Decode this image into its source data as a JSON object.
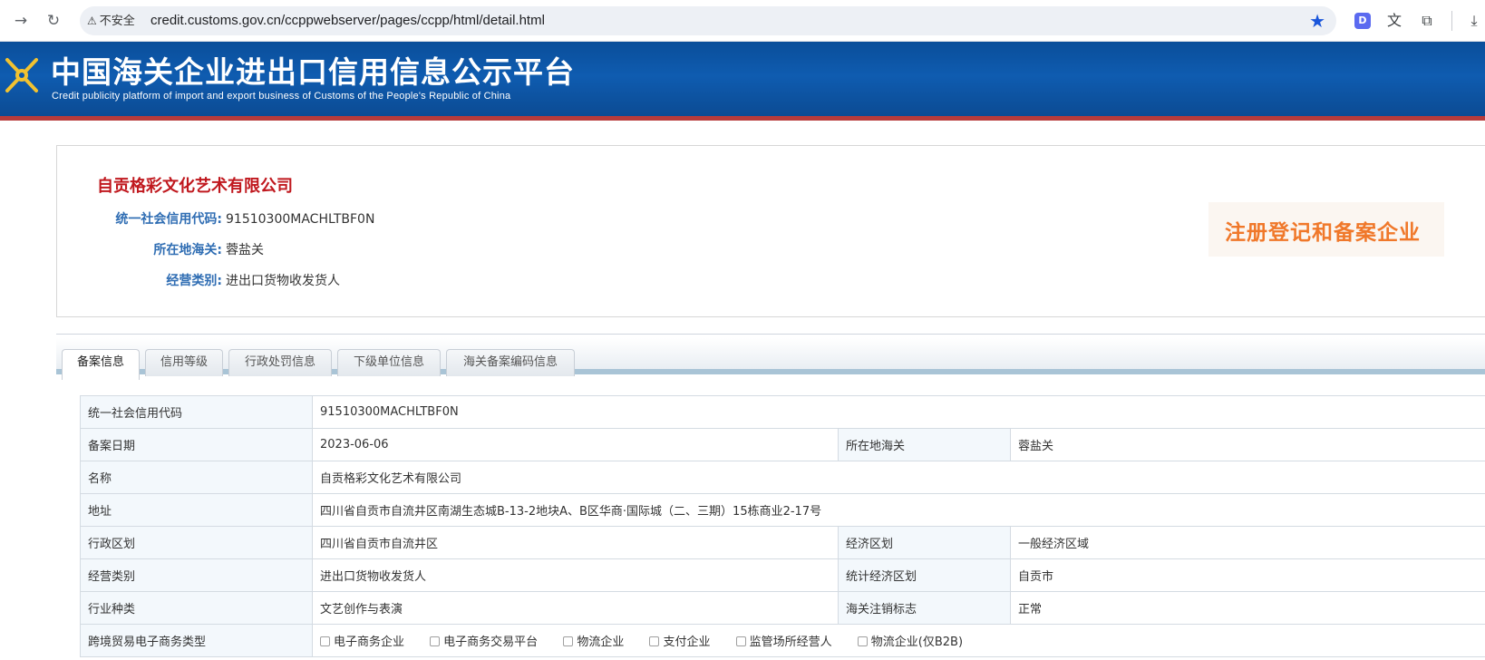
{
  "browser": {
    "security_label": "不安全",
    "url": "credit.customs.gov.cn/ccppwebserver/pages/ccpp/html/detail.html"
  },
  "banner": {
    "title": "中国海关企业进出口信用信息公示平台",
    "subtitle": "Credit publicity platform of import and export business of Customs of the People's Republic of China"
  },
  "company": {
    "name": "自贡格彩文化艺术有限公司",
    "fields": [
      {
        "label": "统一社会信用代码:",
        "value": "91510300MACHLTBF0N"
      },
      {
        "label": "所在地海关:",
        "value": "蓉盐关"
      },
      {
        "label": "经营类别:",
        "value": "进出口货物收发货人"
      }
    ],
    "badge": "注册登记和备案企业"
  },
  "tabs": [
    "备案信息",
    "信用等级",
    "行政处罚信息",
    "下级单位信息",
    "海关备案编码信息"
  ],
  "table": {
    "credit_code_label": "统一社会信用代码",
    "credit_code": "91510300MACHLTBF0N",
    "reg_date_label": "备案日期",
    "reg_date": "2023-06-06",
    "customs_label": "所在地海关",
    "customs": "蓉盐关",
    "name_label": "名称",
    "name": "自贡格彩文化艺术有限公司",
    "address_label": "地址",
    "address": "四川省自贡市自流井区南湖生态城B-13-2地块A、B区华商·国际城（二、三期）15栋商业2-17号",
    "admin_region_label": "行政区划",
    "admin_region": "四川省自贡市自流井区",
    "econ_region_label": "经济区划",
    "econ_region": "一般经济区域",
    "biz_type_label": "经营类别",
    "biz_type": "进出口货物收发货人",
    "stat_region_label": "统计经济区划",
    "stat_region": "自贡市",
    "industry_label": "行业种类",
    "industry": "文艺创作与表演",
    "cancel_flag_label": "海关注销标志",
    "cancel_flag": "正常",
    "ecommerce_label": "跨境贸易电子商务类型",
    "ecommerce_options": [
      "电子商务企业",
      "电子商务交易平台",
      "物流企业",
      "支付企业",
      "监管场所经营人",
      "物流企业(仅B2B)"
    ]
  }
}
